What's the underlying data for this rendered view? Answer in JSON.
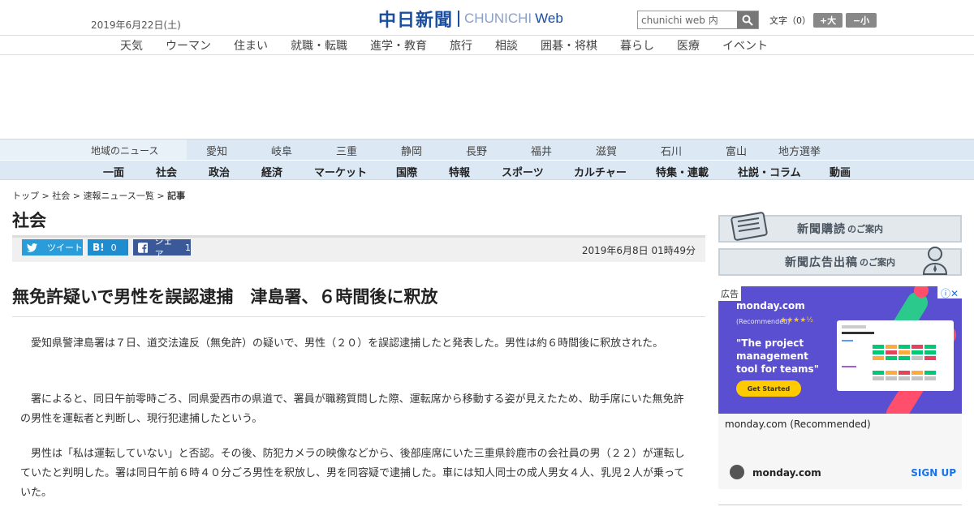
{
  "header": {
    "date": "2019年6月22日(土)",
    "logo_jp": "中日新聞",
    "logo_en": "CHUNICHI",
    "logo_web": "Web",
    "search_value": "chunichi web 内",
    "font_size_label": "文字（0）",
    "font_larger": "+大",
    "font_smaller": "−小",
    "nav": [
      "天気",
      "ウーマン",
      "住まい",
      "就職・転職",
      "進学・教育",
      "旅行",
      "相談",
      "囲碁・将棋",
      "暮らし",
      "医療",
      "イベント"
    ]
  },
  "regions": {
    "label": "地域のニュース",
    "items": [
      "愛知",
      "岐阜",
      "三重",
      "静岡",
      "長野",
      "福井",
      "滋賀",
      "石川",
      "富山",
      "地方選挙"
    ]
  },
  "categories": [
    "一面",
    "社会",
    "政治",
    "経済",
    "マーケット",
    "国際",
    "特報",
    "スポーツ",
    "カルチャー",
    "特集・連載",
    "社説・コラム",
    "動画"
  ],
  "breadcrumb": {
    "items": [
      "トップ",
      "社会",
      "速報ニュース一覧"
    ],
    "current": "記事",
    "sep": " > "
  },
  "section_title": "社会",
  "share": {
    "tweet": "ツイート",
    "hatena": "B!",
    "hatena_count": "0",
    "facebook": "シェア",
    "facebook_count": "1"
  },
  "article": {
    "published": "2019年6月8日 01時49分",
    "headline": "無免許疑いで男性を誤認逮捕　津島署、６時間後に釈放",
    "paragraphs": [
      "愛知県警津島署は７日、道交法違反（無免許）の疑いで、男性（２０）を誤認逮捕したと発表した。男性は約６時間後に釈放された。",
      "署によると、同日午前零時ごろ、同県愛西市の県道で、署員が職務質問した際、運転席から移動する姿が見えたため、助手席にいた無免許の男性を運転者と判断し、現行犯逮捕したという。",
      "男性は「私は運転していない」と否認。その後、防犯カメラの映像などから、後部座席にいた三重県鈴鹿市の会社員の男（２２）が運転していたと判明した。署は同日午前６時４０分ごろ男性を釈放し、男を同容疑で逮捕した。車には知人同士の成人男女４人、乳児２人が乗っていた。"
    ]
  },
  "sidebar": {
    "banner1_main": "新聞購読",
    "banner1_sub": "のご案内",
    "banner2_main": "新聞広告出稿",
    "banner2_sub": "のご案内"
  },
  "ad": {
    "tag": "広告",
    "brand": "monday.com",
    "recommended": "(Recommended)",
    "stars": "★★★★½",
    "tagline": "\"The project management tool for teams\"",
    "cta": "Get Started",
    "caption": "monday.com (Recommended)",
    "domain": "monday.com",
    "signup": "SIGN UP"
  }
}
